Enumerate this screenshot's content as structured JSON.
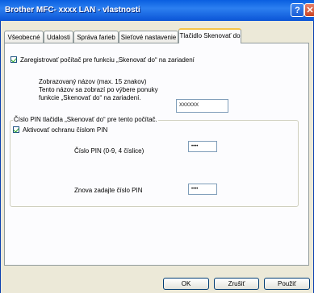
{
  "window": {
    "title": "Brother MFC- xxxx   LAN - vlastnosti",
    "help_label": "?",
    "close_label": "✕"
  },
  "tabs": [
    {
      "label": "Všeobecné",
      "active": false
    },
    {
      "label": "Udalosti",
      "active": false
    },
    {
      "label": "Správa farieb",
      "active": false
    },
    {
      "label": "Sieťové nastavenie",
      "active": false
    },
    {
      "label": "Tlačidlo Skenovať do",
      "active": true
    }
  ],
  "panel": {
    "register_checkbox_label": "Zaregistrovať počítač pre funkciu „Skenovať do“ na zariadení",
    "register_checked": true,
    "display_name_label_line1": "Zobrazovaný názov (max. 15 znakov)",
    "display_name_label_line2": "Tento názov sa zobrazí po výbere ponuky",
    "display_name_label_line3": "funkcie „Skenovať do“ na zariadení.",
    "display_name_value": "XXXXXX",
    "pin_group_label": "Číslo PIN tlačidla „Skenovať do“ pre tento počítač.",
    "pin_protect_label": "Aktivovať ochranu číslom PIN",
    "pin_protect_checked": true,
    "pin_label": "Číslo PIN (0-9, 4 číslice)",
    "pin_value": "••••",
    "pin_confirm_label": "Znova zadajte číslo PIN",
    "pin_confirm_value": "••••"
  },
  "buttons": {
    "ok": "OK",
    "cancel": "Zrušiť",
    "apply": "Použiť"
  }
}
